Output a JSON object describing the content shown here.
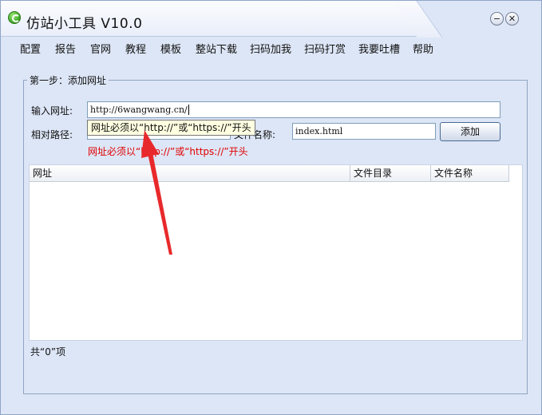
{
  "window": {
    "title": "仿站小工具 V10.0",
    "app_icon": "green-refresh-icon",
    "controls": {
      "minimize": "minimize-icon",
      "close": "close-icon"
    }
  },
  "menu": [
    {
      "label": "配置"
    },
    {
      "label": "报告"
    },
    {
      "label": "官网"
    },
    {
      "label": "教程"
    },
    {
      "label": "模板"
    },
    {
      "label": "整站下载"
    },
    {
      "label": "扫码加我"
    },
    {
      "label": "扫码打赏"
    },
    {
      "label": "我要吐槽"
    },
    {
      "label": "帮助"
    }
  ],
  "step1": {
    "legend": "第一步：添加网址",
    "url_label": "输入网址:",
    "url_value": "http://6wangwang.cn/",
    "relpath_label": "相对路径:",
    "relpath_value": "",
    "filename_label": "文件名称:",
    "filename_value": "index.html",
    "add_button": "添加",
    "tooltip": "网址必须以“http://”或“https://”开头",
    "error": "网址必须以“http://”或“https://”开头"
  },
  "list": {
    "columns": [
      "网址",
      "文件目录",
      "文件名称"
    ],
    "rows": []
  },
  "footer": {
    "count_text": "共“0”项"
  },
  "colors": {
    "window_bg": "#dde6f6",
    "error": "#e00000",
    "tooltip_bg": "#ffffe1",
    "arrow": "#e8292b"
  }
}
